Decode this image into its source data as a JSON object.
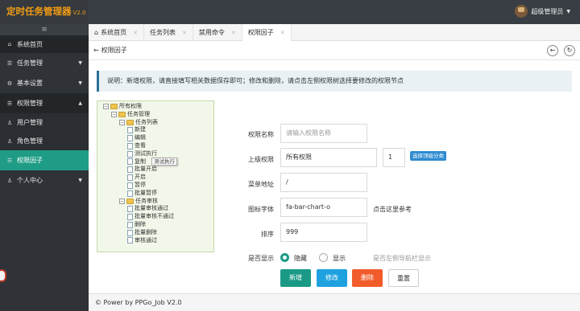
{
  "app": {
    "title": "定时任务管理器",
    "version": "V2.0"
  },
  "user": {
    "name": "超级管理员"
  },
  "sidebar": {
    "toggle_icon": "≡",
    "items": [
      {
        "label": "系统首页",
        "icon": "home-icon"
      },
      {
        "label": "任务管理",
        "icon": "list-icon"
      },
      {
        "label": "基本设置",
        "icon": "cogs-icon"
      },
      {
        "label": "权限管理",
        "icon": "list-icon"
      },
      {
        "label": "用户管理",
        "icon": "user-icon"
      },
      {
        "label": "角色管理",
        "icon": "user-group-icon"
      },
      {
        "label": "权限因子",
        "icon": "list-icon"
      },
      {
        "label": "个人中心",
        "icon": "user-icon"
      }
    ]
  },
  "tabs": [
    {
      "label": "系统首页",
      "icon": "home-icon"
    },
    {
      "label": "任务列表"
    },
    {
      "label": "禁用命令"
    },
    {
      "label": "权限因子"
    }
  ],
  "page": {
    "title": "权限因子",
    "back_icon": "←",
    "refresh_icon": "↻",
    "prev_icon": "←"
  },
  "note": "说明：新增权限，请直接填写相关数据保存即可；修改和删除，请点击左侧权限树选择要修改的权限节点",
  "tree": {
    "root": "所有权限",
    "nodes": [
      {
        "label": "任务管理",
        "level": 1,
        "type": "folder"
      },
      {
        "label": "任务列表",
        "level": 2,
        "type": "folder"
      },
      {
        "label": "新建",
        "level": 3,
        "type": "file"
      },
      {
        "label": "编辑",
        "level": 3,
        "type": "file"
      },
      {
        "label": "查看",
        "level": 3,
        "type": "file"
      },
      {
        "label": "测试执行",
        "level": 3,
        "type": "file"
      },
      {
        "label": "复制",
        "level": 3,
        "type": "file"
      },
      {
        "label": "批量开启",
        "level": 3,
        "type": "file"
      },
      {
        "label": "开启",
        "level": 3,
        "type": "file"
      },
      {
        "label": "暂停",
        "level": 3,
        "type": "file"
      },
      {
        "label": "批量暂停",
        "level": 3,
        "type": "file"
      },
      {
        "label": "任务审核",
        "level": 2,
        "type": "folder"
      },
      {
        "label": "批量审核通过",
        "level": 3,
        "type": "file"
      },
      {
        "label": "批量审核不通过",
        "level": 3,
        "type": "file"
      },
      {
        "label": "删除",
        "level": 3,
        "type": "file"
      },
      {
        "label": "批量删除",
        "level": 3,
        "type": "file"
      },
      {
        "label": "审核通过",
        "level": 3,
        "type": "file"
      }
    ],
    "tooltip": "测试执行"
  },
  "form": {
    "name_label": "权限名称",
    "name_placeholder": "请输入权限名称",
    "parent_label": "上级权限",
    "parent_value": "所有权限",
    "parent_id": "1",
    "top_button": "选择顶级分类",
    "url_label": "菜单地址",
    "url_value": "/",
    "icon_label": "图标字体",
    "icon_value": "fa-bar-chart-o",
    "icon_link": "点击这里参考",
    "sort_label": "排序",
    "sort_value": "999",
    "show_label": "是否显示",
    "hide_option": "隐藏",
    "show_option": "显示",
    "show_hint": "是否左侧导航栏显示"
  },
  "buttons": {
    "add": "新增",
    "edit": "修改",
    "delete": "删除",
    "reset": "重置"
  },
  "footer": "© Power by PPGo_Job V2.0",
  "colors": {
    "accent": "#1f9c86",
    "brand": "#f39c12",
    "edit": "#1fa1e0",
    "delete": "#f25c2b"
  }
}
